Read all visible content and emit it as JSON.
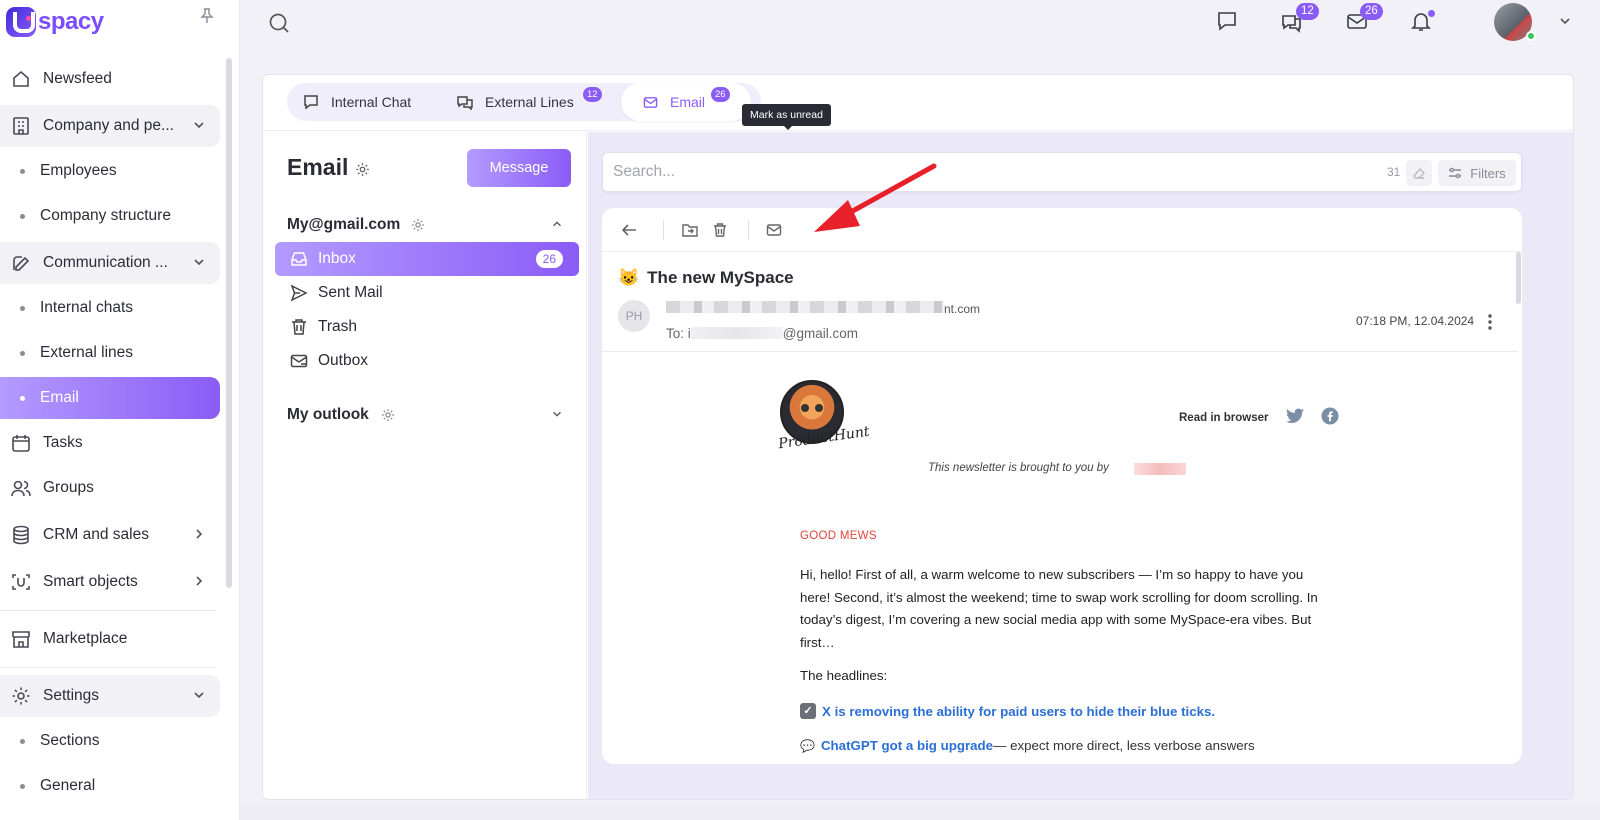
{
  "app": {
    "name": "spacy"
  },
  "sidebar": {
    "items": [
      {
        "label": "Newsfeed",
        "icon": "home-icon"
      },
      {
        "label": "Company and pe...",
        "icon": "building-icon",
        "expanded": true
      },
      {
        "label": "Employees",
        "sub": true
      },
      {
        "label": "Company structure",
        "sub": true
      },
      {
        "label": "Communication ...",
        "icon": "communication-icon",
        "expanded": true
      },
      {
        "label": "Internal chats",
        "sub": true
      },
      {
        "label": "External lines",
        "sub": true
      },
      {
        "label": "Email",
        "sub": true,
        "active": true
      },
      {
        "label": "Tasks",
        "icon": "calendar-icon"
      },
      {
        "label": "Groups",
        "icon": "users-icon"
      },
      {
        "label": "CRM and sales",
        "icon": "database-icon"
      },
      {
        "label": "Smart objects",
        "icon": "scan-icon"
      },
      {
        "label": "Marketplace",
        "icon": "store-icon"
      },
      {
        "label": "Settings",
        "icon": "gear-icon",
        "expanded": true
      },
      {
        "label": "Sections",
        "sub": true
      },
      {
        "label": "General",
        "sub": true
      }
    ]
  },
  "topbar": {
    "chats_badge": "12",
    "mail_badge": "26"
  },
  "tabs": [
    {
      "label": "Internal Chat",
      "icon": "chat-icon"
    },
    {
      "label": "External Lines",
      "icon": "external-chat-icon",
      "badge": "12"
    },
    {
      "label": "Email",
      "icon": "mail-icon",
      "badge": "26",
      "active": true
    }
  ],
  "mail": {
    "title": "Email",
    "new_message_label": "Message",
    "accounts": [
      {
        "name": "My@gmail.com",
        "expanded": true
      },
      {
        "name": "My outlook",
        "expanded": false
      }
    ],
    "folders": [
      {
        "label": "Inbox",
        "count": "26",
        "icon": "inbox-icon",
        "active": true
      },
      {
        "label": "Sent Mail",
        "icon": "send-icon"
      },
      {
        "label": "Trash",
        "icon": "trash-icon"
      },
      {
        "label": "Outbox",
        "icon": "outbox-icon"
      }
    ]
  },
  "search": {
    "placeholder": "Search...",
    "count": "31",
    "filters_label": "Filters"
  },
  "message": {
    "tooltip": "Mark as unread",
    "subject_emoji": "😺",
    "subject": "The new MySpace",
    "sender_initials": "PH",
    "sender_tail": "nt.com",
    "to_prefix": "To: i",
    "to_suffix": "@gmail.com",
    "date": "07:18 PM, 12.04.2024",
    "newsletter": {
      "logo_script": "ProductHunt",
      "read_in_browser": "Read in browser",
      "brought_by": "This newsletter is brought to you by",
      "section_label": "GOOD MEWS",
      "intro": "Hi, hello! First of all, a warm welcome to new subscribers — I’m so happy to have you here! Second, it’s almost the weekend; time to swap work scrolling for doom scrolling. In today’s digest, I’m covering a new social media app with some MySpace-era vibes. But first…",
      "headlines_label": "The headlines:",
      "headline_1": "X is removing the ability for paid users to hide their blue ticks.",
      "headline_2": "ChatGPT got a big upgrade",
      "headline_2_rest": "— expect more direct, less verbose answers"
    }
  },
  "colors": {
    "accent": "#8a5cf6",
    "accent_light": "#b39bff",
    "link": "#2b6fd6",
    "red_label": "#e0443a",
    "arrow": "#e8202a"
  }
}
